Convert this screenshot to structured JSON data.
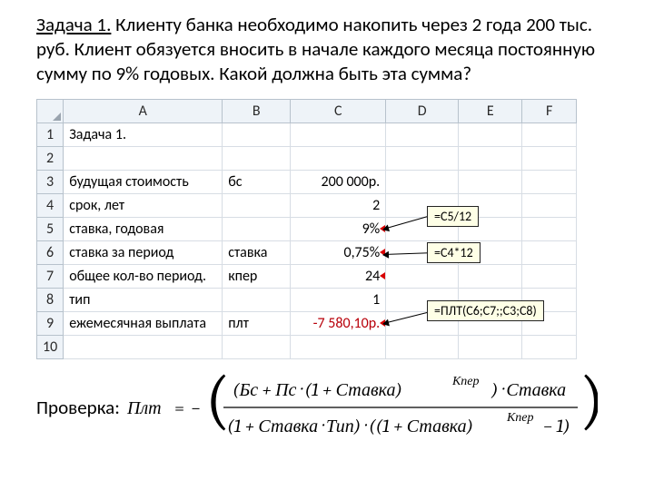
{
  "task": {
    "label": "Задача 1.",
    "body": " Клиенту банка необходимо накопить  через 2 года 200 тыс. руб. Клиент обязуется вносить в начале каждого месяца постоянную сумму по 9% годовых. Какой должна быть эта сумма?"
  },
  "sheet": {
    "cols": [
      "A",
      "B",
      "C",
      "D",
      "E",
      "F"
    ],
    "rows": [
      {
        "n": "1",
        "A": "Задача 1.",
        "B": "",
        "C": ""
      },
      {
        "n": "2",
        "A": "",
        "B": "",
        "C": ""
      },
      {
        "n": "3",
        "A": "будущая стоимость",
        "B": "бс",
        "C": "200 000р."
      },
      {
        "n": "4",
        "A": "срок, лет",
        "B": "",
        "C": "2"
      },
      {
        "n": "5",
        "A": "ставка, годовая",
        "B": "",
        "C": "9%"
      },
      {
        "n": "6",
        "A": "ставка за период",
        "B": "ставка",
        "C": "0,75%"
      },
      {
        "n": "7",
        "A": "общее кол-во период.",
        "B": "кпер",
        "C": "24"
      },
      {
        "n": "8",
        "A": "тип",
        "B": "",
        "C": "1"
      },
      {
        "n": "9",
        "A": "ежемесячная выплата",
        "B": "плт",
        "C": "-7 580,10р."
      },
      {
        "n": "10",
        "A": "",
        "B": "",
        "C": ""
      }
    ]
  },
  "callouts": {
    "c6": "=C5/12",
    "c7": "=C4*12",
    "c9": "=ПЛТ(С6;С7;;С3;С8)"
  },
  "check_label": "Проверка:",
  "formula": {
    "lhs": "Плт",
    "eq": "=",
    "minus": "−",
    "n_left": "(Бс + Пс · (1 + Ставка)",
    "exp_kper": "Кпер",
    "n_right": ") · Ставка",
    "d_left": "(1 + Ставка · Тип) · ((1 + Ставка)",
    "d_right": " − 1)"
  }
}
